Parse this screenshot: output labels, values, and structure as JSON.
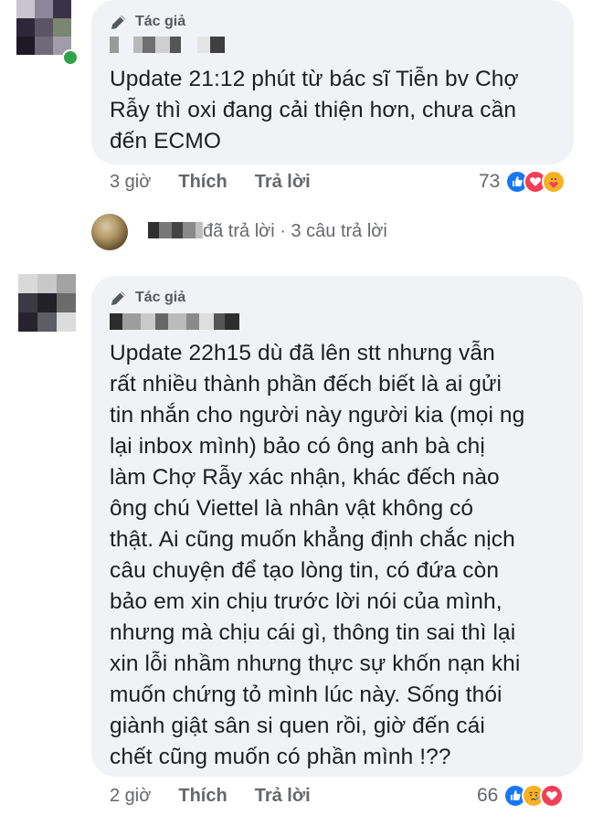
{
  "comments": [
    {
      "author_tag": "Tác giả",
      "text": "Update 21:12 phút từ bác sĩ Tiễn bv Chợ\nRẫy thì oxi đang cải thiện hơn, chưa cần\nđến ECMO",
      "time": "3 giờ",
      "like_label": "Thích",
      "reply_label": "Trả lời",
      "reaction_count": "73",
      "reactions": [
        "like-icon",
        "love-icon",
        "care-icon"
      ]
    },
    {
      "author_tag": "Tác giả",
      "text": "Update 22h15 dù đã lên stt nhưng vẫn\nrất nhiều thành phần đếch biết là ai gửi\ntin nhắn cho người này người kia (mọi ng\nlại inbox mình) bảo có ông anh bà chị\nlàm Chợ Rẫy xác nhận, khác đếch nào\nông chú Viettel là nhân vật không có\nthật. Ai cũng muốn khẳng định chắc nịch\ncâu chuyện để tạo lòng tin, có đứa còn\nbảo em xin chịu trước lời nói của mình,\nnhưng mà chịu cái gì, thông tin sai thì lại\nxin lỗi nhầm nhưng thực sự khốn nạn khi\nmuốn chứng tỏ mình lúc này. Sống thói\ngiành giật sân si quen rồi, giờ đến cái\nchết cũng muốn có phần mình !??",
      "time": "2 giờ",
      "like_label": "Thích",
      "reply_label": "Trả lời",
      "reaction_count": "66",
      "reactions": [
        "like-icon",
        "sad-icon",
        "love-icon"
      ]
    }
  ],
  "reply_summary": {
    "text": "đã trả lời · 3 câu trả lời"
  },
  "colors": {
    "bubble": "#f0f2f5",
    "meta": "#65676b",
    "like": "#1877f2",
    "love": "#f33e58",
    "care": "#f7b125",
    "online": "#31a24c"
  }
}
